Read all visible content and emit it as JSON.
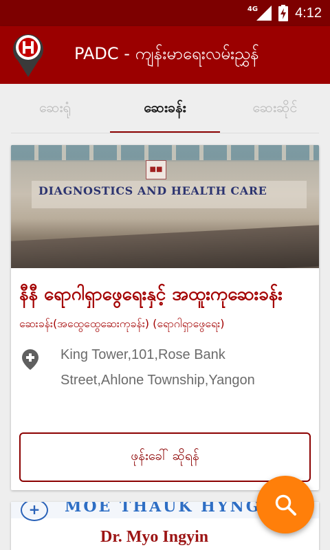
{
  "status_bar": {
    "network": "4G",
    "time": "4:12",
    "icons": [
      "signal-icon",
      "battery-charging-icon"
    ]
  },
  "app_bar": {
    "title": "PADC - ကျန်းမာရေးလမ်းညွှန်",
    "logo_icon": "hospital-pin-logo-icon"
  },
  "tabs": [
    {
      "label": "ဆေးရုံ",
      "active": false
    },
    {
      "label": "ဆေးခန်း",
      "active": true
    },
    {
      "label": "ဆေးဆိုင်",
      "active": false
    }
  ],
  "cards": [
    {
      "image_sign": "DIAGNOSTICS AND HEALTH CARE",
      "title": "နီနီ ရောဂါရှာဖွေရေးနှင့် အထူးကုဆေးခန်း",
      "category": "ဆေးခန်း(အထွေထွေဆေးကုခန်း) (ရောဂါရှာဖွေရေး)",
      "address": "King Tower,101,Rose Bank Street,Ahlone Township,Yangon",
      "call_label": "ဖုန်းခေါ် ဆိုရန်"
    },
    {
      "image_banner": "MOE THAUK HYNG",
      "image_name": "Dr. Myo Ingyin"
    }
  ],
  "fab": {
    "icon": "search-icon"
  },
  "colors": {
    "status_bar": "#7d0000",
    "app_bar": "#9b0000",
    "accent": "#a30000",
    "fab": "#ff7f0a"
  }
}
